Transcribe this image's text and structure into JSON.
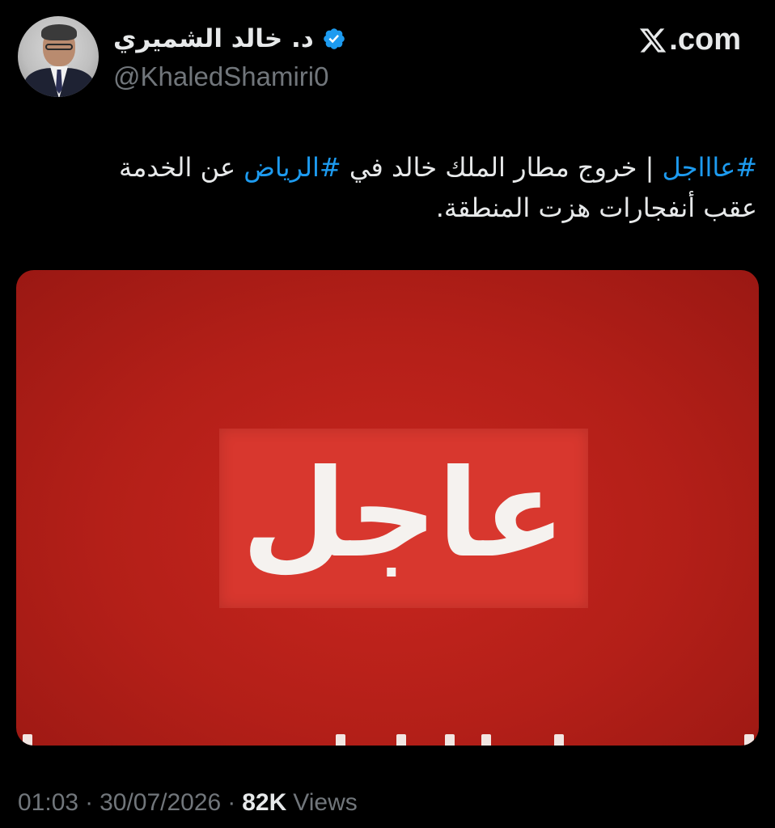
{
  "author": {
    "display_name": "د. خالد الشميري",
    "handle": "@KhaledShamiri0",
    "verified": true,
    "avatar_icon": "person-photo-icon",
    "verified_icon": "verified-badge-icon"
  },
  "brand": {
    "label": ".com",
    "icon": "x-logo-icon"
  },
  "tweet": {
    "hashtag_breaking": "#عاااجل",
    "text_part1": " | خروج مطار الملك خالد في ",
    "hashtag_city": "#الرياض",
    "text_part2": " عن الخدمة",
    "line2": "عقب أنفجارات هزت المنطقة."
  },
  "media": {
    "label": "عاجل"
  },
  "meta": {
    "time": "01:03",
    "sep1": "·",
    "date": "30/07/2026",
    "sep2": "·",
    "views_count": "82K",
    "views_label": "Views"
  },
  "colors": {
    "background": "#000000",
    "text_primary": "#e7e9ea",
    "text_secondary": "#71767b",
    "accent_blue": "#1d9bf0",
    "media_red": "#b31f18",
    "badge_red": "#d8372e"
  }
}
